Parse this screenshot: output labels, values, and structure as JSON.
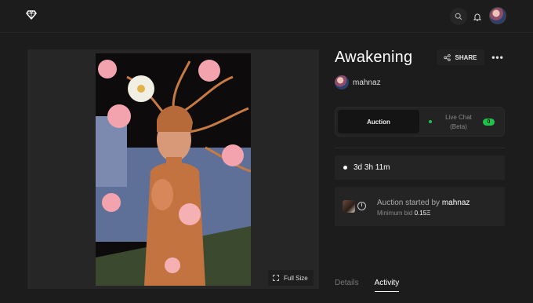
{
  "header": {
    "logo_icon": "diamond-icon",
    "search_icon": "search-icon",
    "bell_icon": "bell-icon"
  },
  "artwork": {
    "full_size_label": "Full Size"
  },
  "nft": {
    "title": "Awakening",
    "share_label": "SHARE",
    "more_label": "•••",
    "creator": "mahnaz"
  },
  "auction_tabs": {
    "auction_label": "Auction",
    "live_chat_label": "Live Chat (Beta)",
    "live_count": "0"
  },
  "timer": {
    "remaining": "3d 3h 11m"
  },
  "activity_event": {
    "text": "Auction started by",
    "user": "mahnaz",
    "min_bid_label": "Minimum bid",
    "min_bid_value": "0.15Ξ"
  },
  "bottom_tabs": {
    "details": "Details",
    "activity": "Activity"
  },
  "colors": {
    "background": "#1c1c1c",
    "card": "#242424",
    "live_green": "#1fc24a"
  }
}
